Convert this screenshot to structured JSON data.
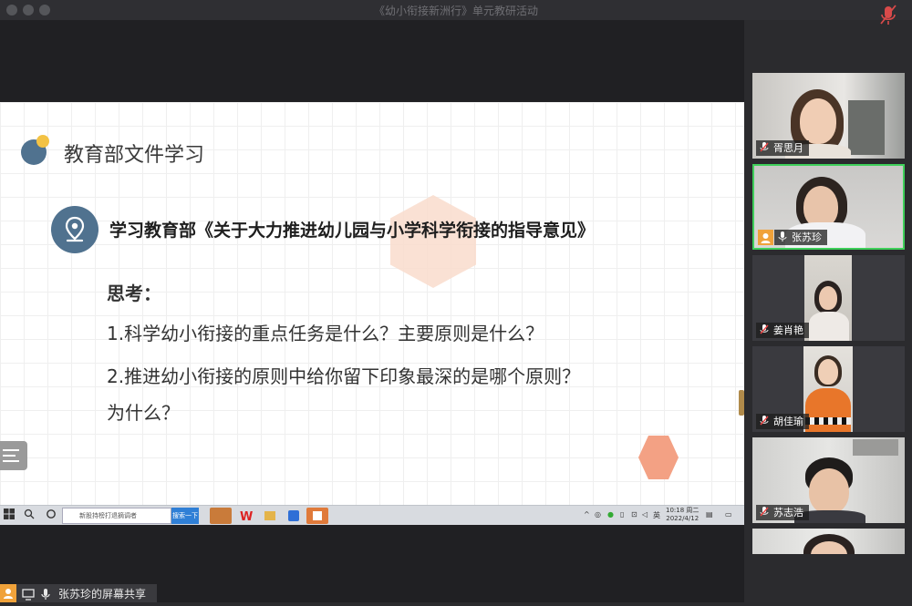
{
  "window": {
    "title": "《幼小衔接新洲行》单元教研活动"
  },
  "slide": {
    "heading": "教育部文件学习",
    "doc_title": "学习教育部《关于大力推进幼儿园与小学科学衔接的指导意见》",
    "think_label": "思考：",
    "question_1": "1.科学幼小衔接的重点任务是什么？主要原则是什么？",
    "question_2": "2.推进幼小衔接的原则中给你留下印象最深的是哪个原则？",
    "question_2_cont": "为什么？"
  },
  "taskbar": {
    "search_text": "新股持榜打退摘调者",
    "search_button": "搜索一下",
    "ime": "英",
    "time": "10:18 周二",
    "date": "2022/4/12"
  },
  "share_bar": {
    "label": "张苏珍的屏幕共享"
  },
  "participants": [
    {
      "name": "胥思月",
      "muted": true
    },
    {
      "name": "张苏珍",
      "muted": false,
      "active": true
    },
    {
      "name": "姜肖艳",
      "muted": true
    },
    {
      "name": "胡佳瑜",
      "muted": true
    },
    {
      "name": "苏志浩",
      "muted": true
    }
  ],
  "colors": {
    "accent_blue": "#50728f",
    "accent_yellow": "#f3c244",
    "hex_orange": "#f3a184",
    "active_border": "#3fcf5a",
    "share_badge": "#f0a23a"
  },
  "icons": [
    "mic-muted-icon",
    "mic-icon",
    "location-pin-icon",
    "menu-icon",
    "windows-start-icon",
    "screen-share-icon"
  ]
}
